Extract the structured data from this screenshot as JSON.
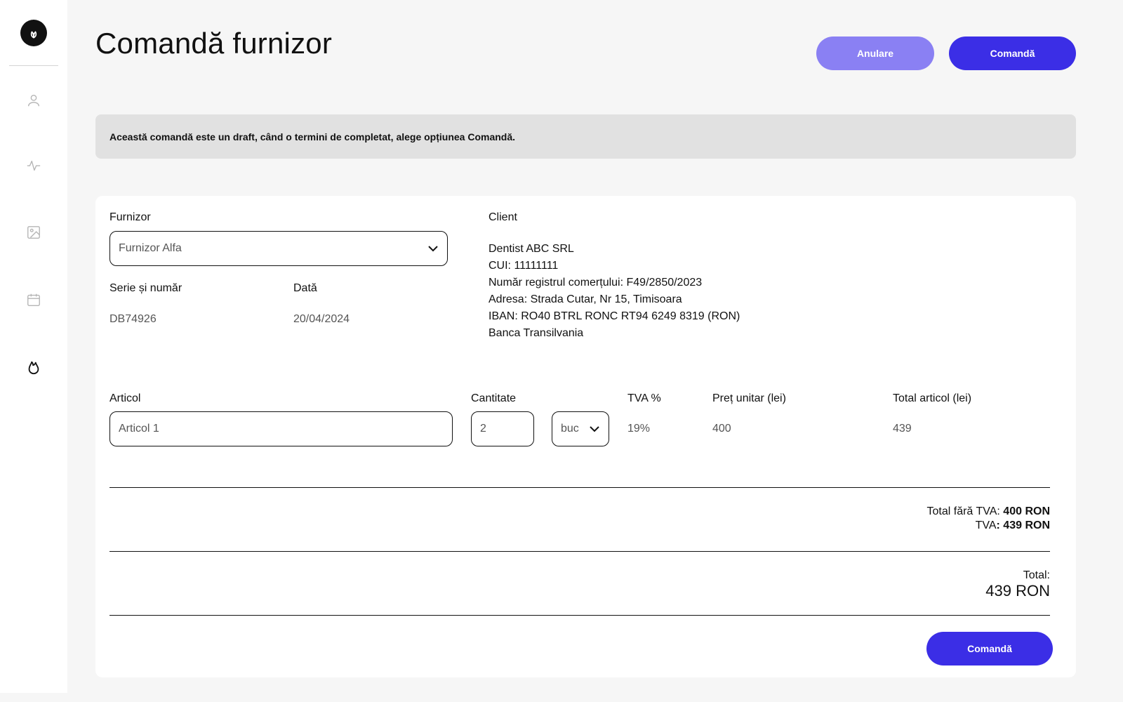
{
  "page": {
    "title": "Comandă furnizor"
  },
  "actions": {
    "cancel_label": "Anulare",
    "order_label": "Comandă"
  },
  "banner": {
    "text": "Această comandă este un draft, când o termini de completat, alege opțiunea Comandă."
  },
  "sidebar": {
    "logo": "leaf-logo-icon",
    "items": [
      {
        "icon": "user-icon"
      },
      {
        "icon": "activity-icon"
      },
      {
        "icon": "image-icon"
      },
      {
        "icon": "calendar-icon"
      },
      {
        "icon": "flame-icon",
        "active": true
      }
    ]
  },
  "supplier": {
    "label": "Furnizor",
    "selected": "Furnizor Alfa",
    "series_label": "Serie și număr",
    "series_value": "DB74926",
    "date_label": "Dată",
    "date_value": "20/04/2024"
  },
  "client": {
    "label": "Client",
    "lines": [
      "Dentist ABC SRL",
      "CUI: 11111111",
      "Număr registrul comerțului: F49/2850/2023",
      "Adresa: Strada Cutar, Nr 15, Timisoara",
      "IBAN: RO40 BTRL RONC RT94 6249 8319 (RON)",
      "Banca Transilvania"
    ]
  },
  "items": {
    "headers": {
      "article": "Articol",
      "quantity": "Cantitate",
      "vat": "TVA %",
      "unit_price": "Preț unitar (lei)",
      "total": "Total articol (lei)"
    },
    "rows": [
      {
        "article": "Articol 1",
        "quantity": "2",
        "unit": "buc",
        "vat": "19%",
        "unit_price": "400",
        "total": "439"
      }
    ]
  },
  "summary": {
    "subtotal_label": "Total fără TVA:",
    "subtotal_value": "400 RON",
    "vat_label": "TVA",
    "vat_value": ": 439 RON",
    "total_label": "Total:",
    "total_value": "439 RON"
  },
  "colors": {
    "primary": "#3b2ee6",
    "primary_light": "#8a80f3",
    "banner_bg": "#e1e1e1"
  }
}
